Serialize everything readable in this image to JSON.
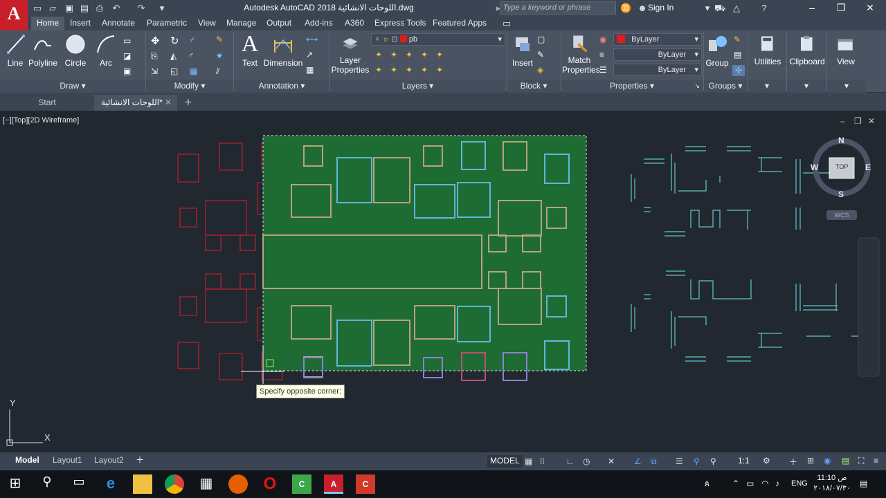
{
  "window": {
    "app_logo": "A",
    "title": "Autodesk AutoCAD 2018    اللوحات الانشائية.dwg",
    "search_placeholder": "Type a keyword or phrase",
    "sign_in": "Sign In"
  },
  "ribbon_tabs": [
    "Home",
    "Insert",
    "Annotate",
    "Parametric",
    "View",
    "Manage",
    "Output",
    "Add-ins",
    "A360",
    "Express Tools",
    "Featured Apps"
  ],
  "ribbon": {
    "draw": {
      "line": "Line",
      "polyline": "Polyline",
      "circle": "Circle",
      "arc": "Arc",
      "footer": "Draw"
    },
    "modify": {
      "footer": "Modify"
    },
    "annotation": {
      "text": "Text",
      "dimension": "Dimension",
      "footer": "Annotation"
    },
    "layers": {
      "layer_properties_1": "Layer",
      "layer_properties_2": "Properties",
      "current_layer": "pb",
      "footer": "Layers"
    },
    "block": {
      "insert": "Insert",
      "footer": "Block"
    },
    "properties": {
      "match_1": "Match",
      "match_2": "Properties",
      "color": "ByLayer",
      "linetype": "ByLayer",
      "lineweight": "ByLayer",
      "footer": "Properties"
    },
    "groups": {
      "group": "Group",
      "footer": "Groups"
    },
    "utilities": "Utilities",
    "clipboard": "Clipboard",
    "view": "View"
  },
  "file_tabs": {
    "start": "Start",
    "drawing": "اللوحات الانشائية*"
  },
  "viewport": {
    "label": "[−][Top][2D Wireframe]",
    "tooltip": "Specify opposite corner:",
    "viewcube": {
      "n": "N",
      "s": "S",
      "e": "E",
      "w": "W",
      "top": "TOP",
      "wcs": "WCS"
    },
    "ucs_y": "Y",
    "ucs_x": "X"
  },
  "layout_tabs": [
    "Model",
    "Layout1",
    "Layout2"
  ],
  "status": {
    "model": "MODEL",
    "scale": "1:1"
  },
  "taskbar": {
    "lang": "ENG",
    "time": "11:10 ص",
    "date": "٢٠١٨/٠٧/٣٠"
  },
  "colors": {
    "red_line": "#c01f2e",
    "green_fill": "#1f6b34",
    "cyan_line": "#5fb8d6",
    "tan_line": "#b7a47a"
  }
}
